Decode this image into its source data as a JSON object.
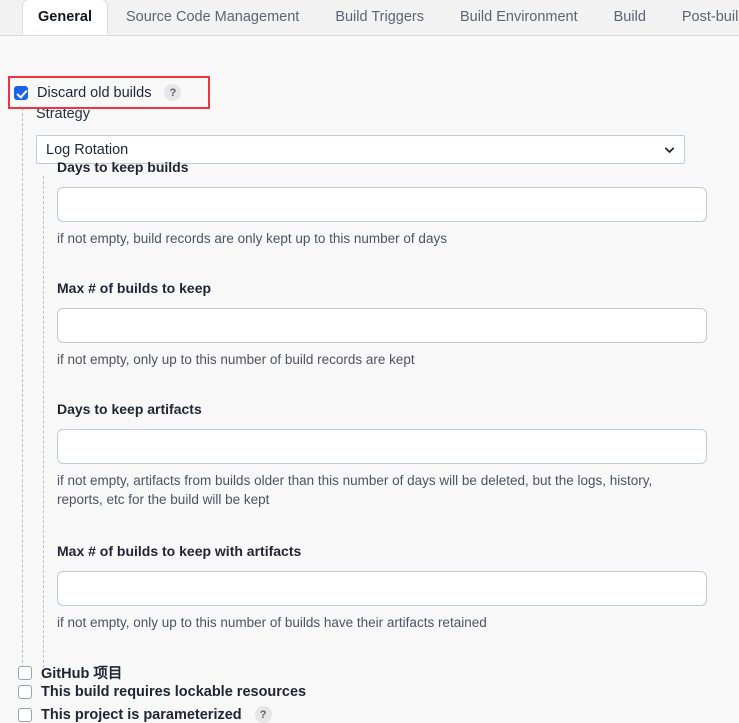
{
  "tabs": [
    {
      "label": "General",
      "active": true
    },
    {
      "label": "Source Code Management",
      "active": false
    },
    {
      "label": "Build Triggers",
      "active": false
    },
    {
      "label": "Build Environment",
      "active": false
    },
    {
      "label": "Build",
      "active": false
    },
    {
      "label": "Post-build Actions",
      "active": false
    }
  ],
  "discard": {
    "label": "Discard old builds",
    "checked": true,
    "help_glyph": "?"
  },
  "strategy": {
    "label": "Strategy",
    "selected": "Log Rotation",
    "chevron": "⌄"
  },
  "fields": [
    {
      "label": "Days to keep builds",
      "value": "",
      "helper": "if not empty, build records are only kept up to this number of days"
    },
    {
      "label": "Max # of builds to keep",
      "value": "",
      "helper": "if not empty, only up to this number of build records are kept"
    },
    {
      "label": "Days to keep artifacts",
      "value": "",
      "helper": "if not empty, artifacts from builds older than this number of days will be deleted, but the logs, history, reports, etc for the build will be kept"
    },
    {
      "label": "Max # of builds to keep with artifacts",
      "value": "",
      "helper": "if not empty, only up to this number of builds have their artifacts retained"
    }
  ],
  "bottom_checkboxes": [
    {
      "label": "GitHub 项目",
      "checked": false,
      "help": false
    },
    {
      "label": "This build requires lockable resources",
      "checked": false,
      "help": false
    },
    {
      "label": "This project is parameterized",
      "checked": false,
      "help": true,
      "help_glyph": "?"
    }
  ],
  "colors": {
    "highlight": "#ef3340",
    "checkbox_checked": "#1a63e8",
    "page_background": "#f8f8f8"
  }
}
